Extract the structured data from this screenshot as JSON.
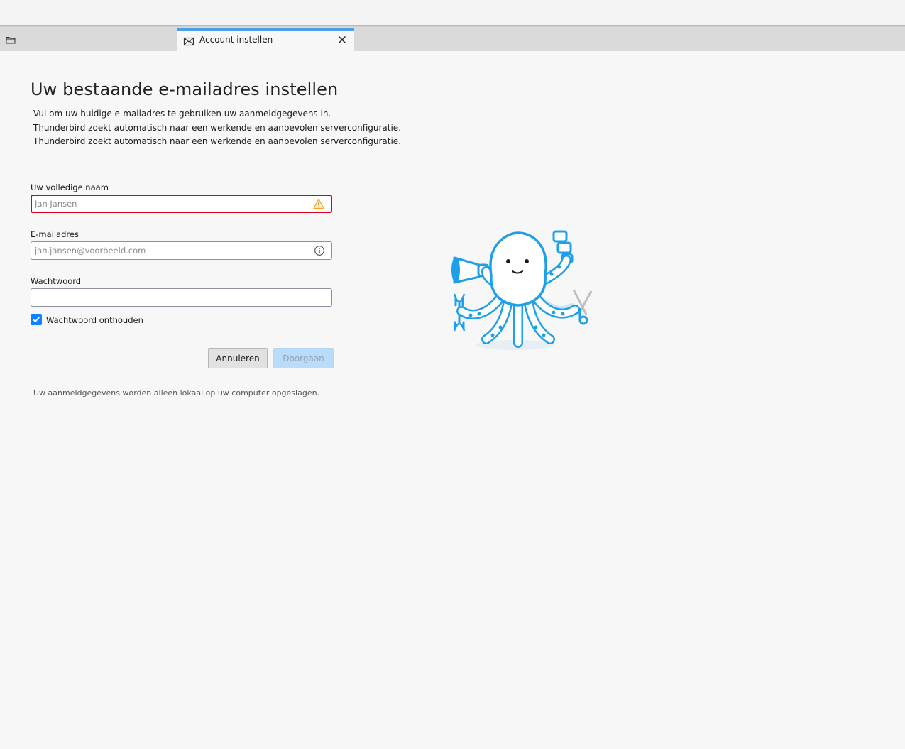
{
  "window": {
    "tab": {
      "label": "Account instellen"
    }
  },
  "page": {
    "title": "Uw bestaande e-mailadres instellen",
    "description_lines": [
      "Vul om uw huidige e-mailadres te gebruiken uw aanmeldgegevens in.",
      "Thunderbird zoekt automatisch naar een werkende en aanbevolen serverconfiguratie.",
      "Thunderbird zoekt automatisch naar een werkende en aanbevolen serverconfiguratie."
    ]
  },
  "form": {
    "name": {
      "label": "Uw volledige naam",
      "placeholder": "Jan Jansen",
      "value": "",
      "status_icon": "warning-icon"
    },
    "email": {
      "label": "E-mailadres",
      "placeholder": "jan.jansen@voorbeeld.com",
      "value": "",
      "status_icon": "info-icon"
    },
    "password": {
      "label": "Wachtwoord",
      "value": ""
    },
    "remember": {
      "label": "Wachtwoord onthouden",
      "checked": true
    },
    "buttons": {
      "cancel": "Annuleren",
      "continue": "Doorgaan"
    },
    "footnote": "Uw aanmeldgegevens worden alleen lokaal op uw computer opgeslagen."
  },
  "colors": {
    "accent": "#0a84ff",
    "tab_indicator": "#4aa0e6",
    "error_border": "#d70022",
    "warning": "#f5a623",
    "mascot_blue": "#1ea0e8"
  }
}
